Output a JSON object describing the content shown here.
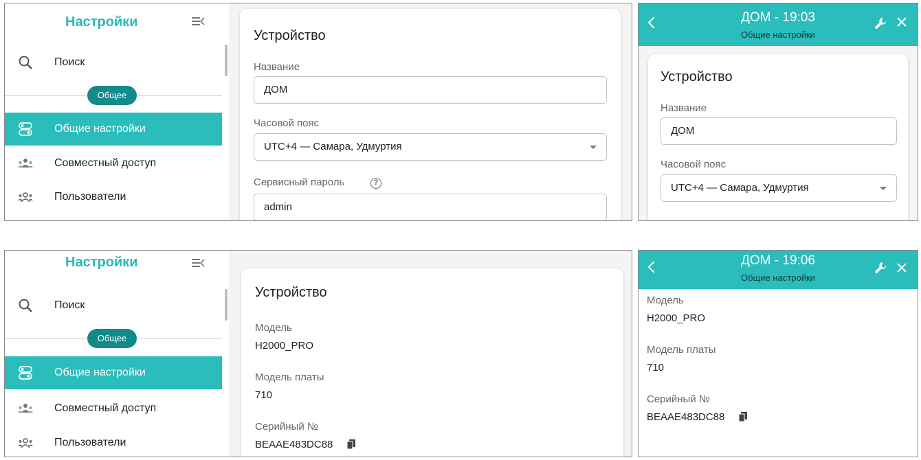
{
  "sidebar": {
    "title": "Настройки",
    "search_label": "Поиск",
    "group_label": "Общее",
    "items": [
      {
        "label": "Общие настройки",
        "icon": "toggles-icon",
        "active": true
      },
      {
        "label": "Совместный доступ",
        "icon": "group-share-icon",
        "active": false
      },
      {
        "label": "Пользователи",
        "icon": "users-icon",
        "active": false
      }
    ]
  },
  "desktop_top": {
    "section_title": "Устройство",
    "name_label": "Название",
    "name_value": "ДОМ",
    "timezone_label": "Часовой пояс",
    "timezone_value": "UTC+4 — Самара, Удмуртия",
    "password_label": "Сервисный пароль",
    "password_value": "admin"
  },
  "mobile_top": {
    "header_title": "ДОМ - 19:03",
    "header_subtitle": "Общие настройки",
    "section_title": "Устройство",
    "name_label": "Название",
    "name_value": "ДОМ",
    "timezone_label": "Часовой пояс",
    "timezone_value": "UTC+4 — Самара, Удмуртия"
  },
  "desktop_bottom": {
    "section_title": "Устройство",
    "model_label": "Модель",
    "model_value": "H2000_PRO",
    "board_label": "Модель платы",
    "board_value": "710",
    "serial_label": "Серийный №",
    "serial_value": "BEAAE483DC88"
  },
  "mobile_bottom": {
    "header_title": "ДОМ - 19:06",
    "header_subtitle": "Общие настройки",
    "model_label": "Модель",
    "model_value": "H2000_PRO",
    "board_label": "Модель платы",
    "board_value": "710",
    "serial_label": "Серийный №",
    "serial_value": "BEAAE483DC88"
  },
  "colors": {
    "accent": "#2bbcbc",
    "pill": "#138a8a"
  }
}
